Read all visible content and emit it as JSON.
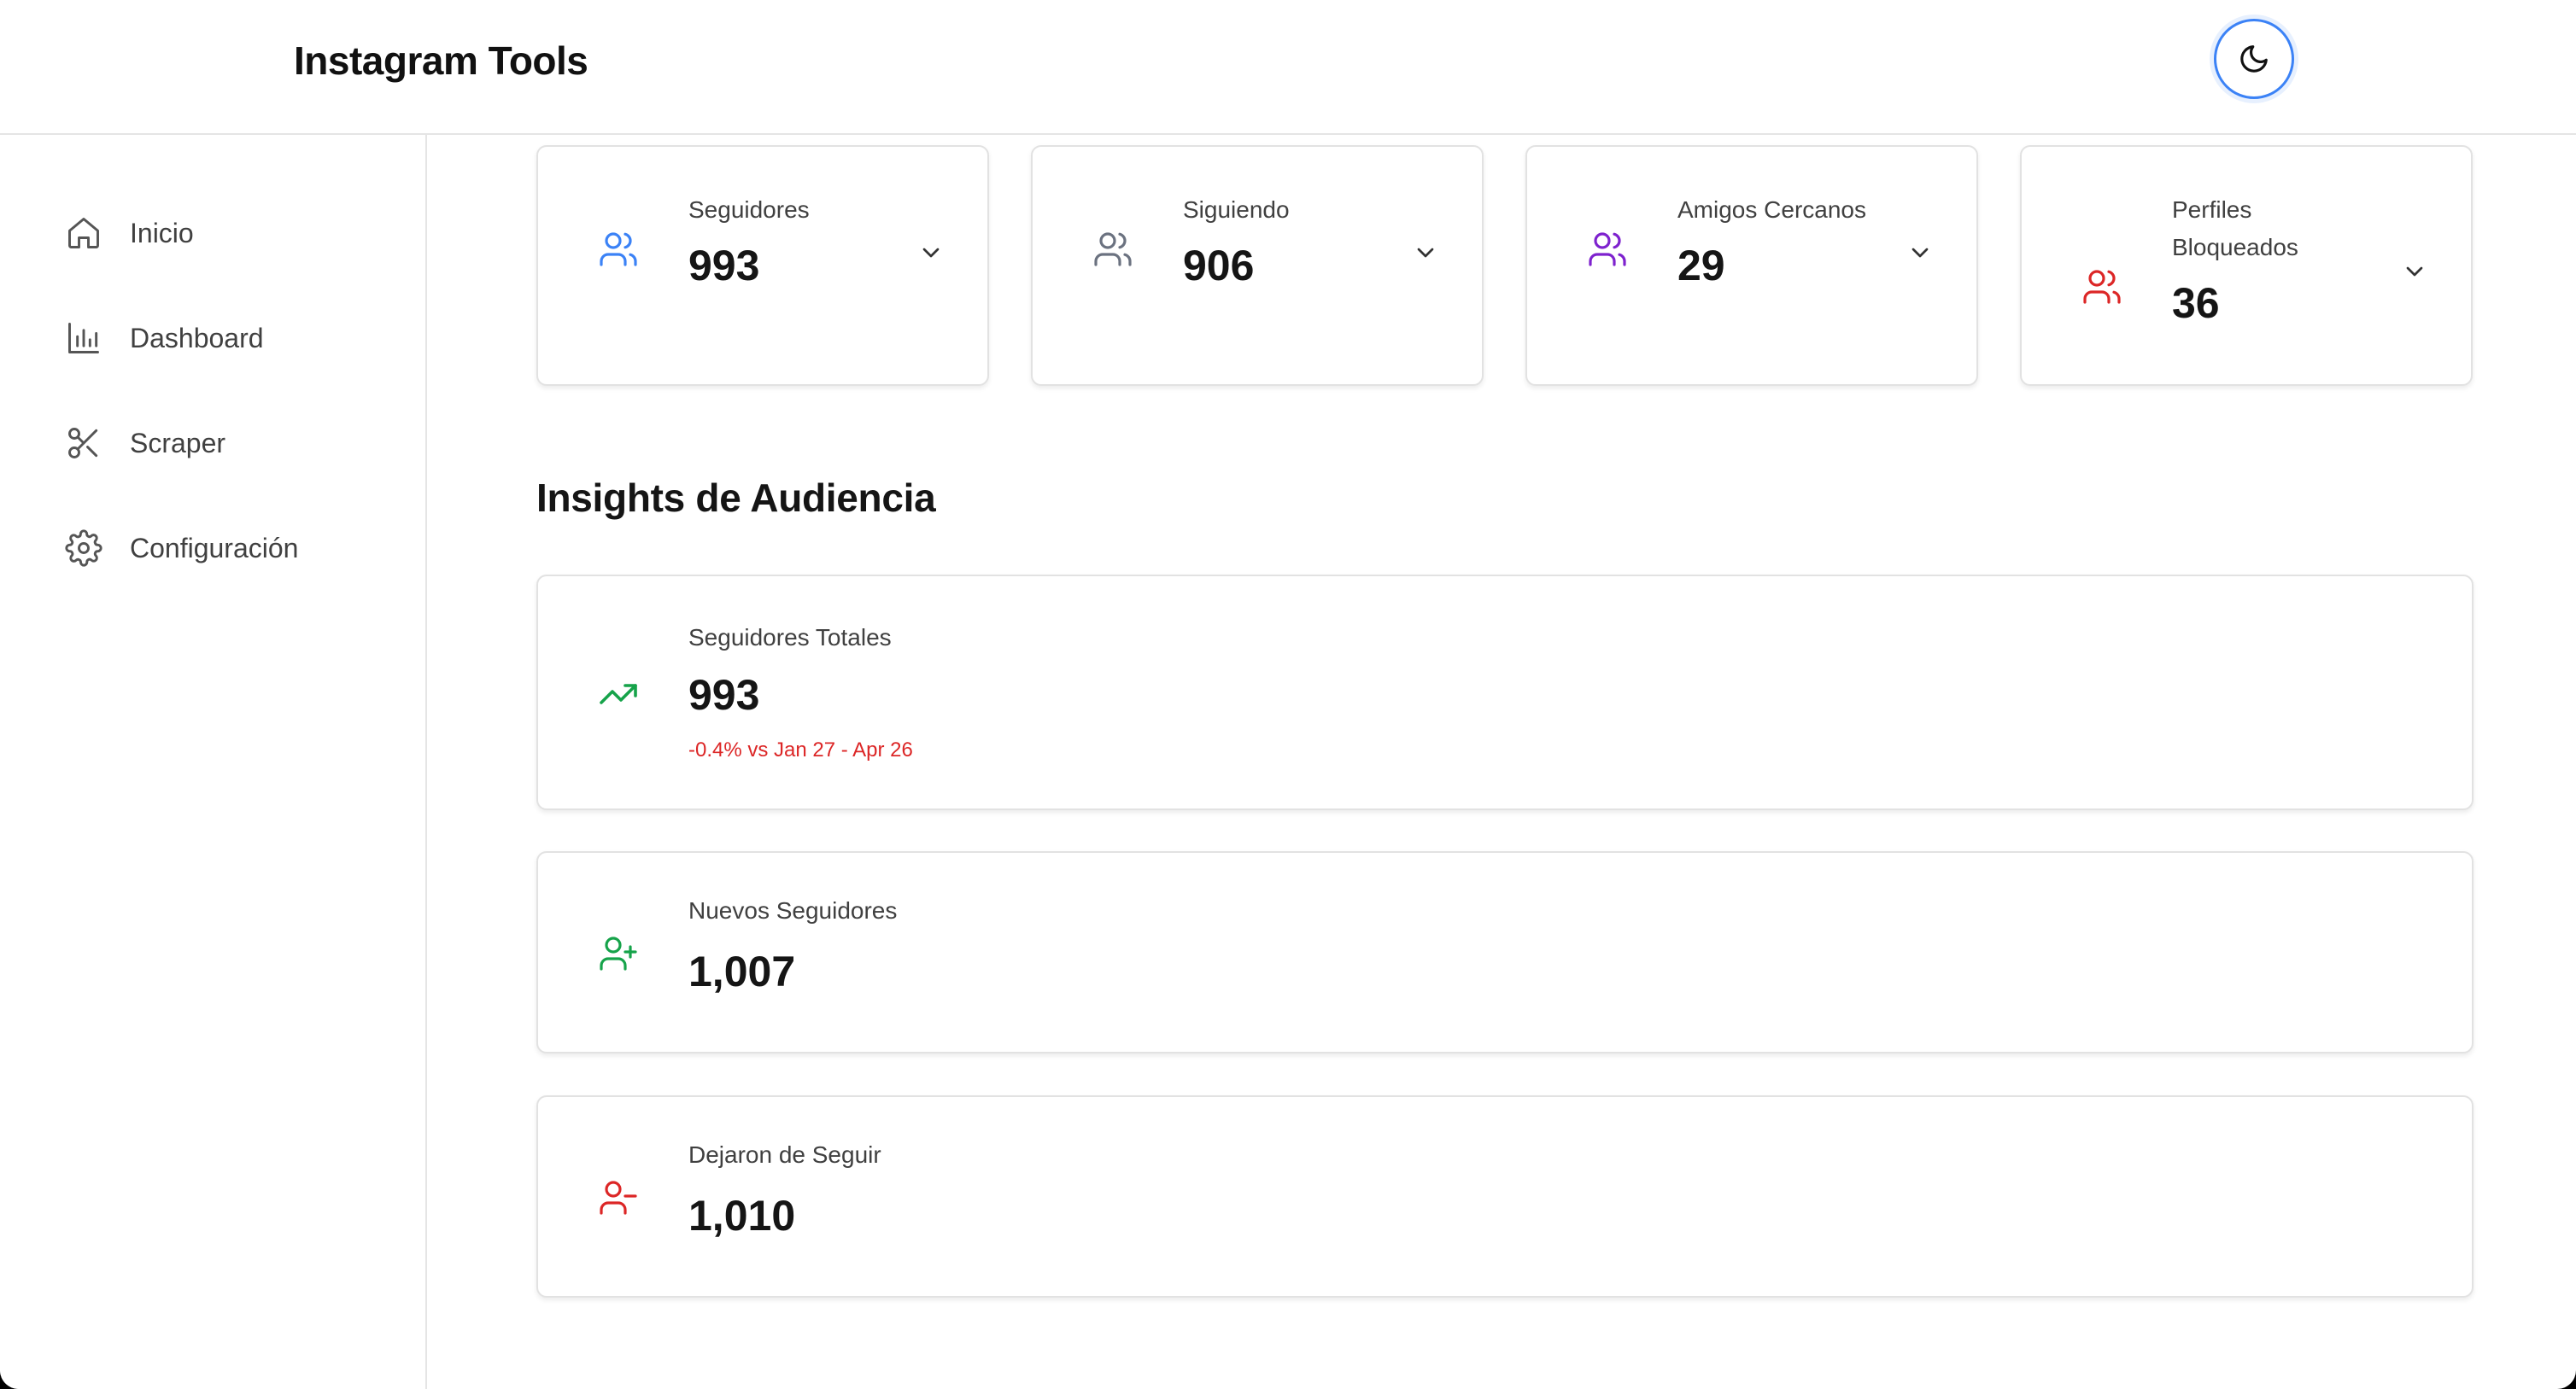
{
  "header": {
    "title": "Instagram Tools",
    "theme_icon": "moon-icon"
  },
  "sidebar": {
    "items": [
      {
        "label": "Inicio",
        "icon": "home-icon"
      },
      {
        "label": "Dashboard",
        "icon": "bar-chart-icon"
      },
      {
        "label": "Scraper",
        "icon": "scissors-icon"
      },
      {
        "label": "Configuración",
        "icon": "gear-icon"
      }
    ]
  },
  "stats": [
    {
      "label": "Seguidores",
      "value": "993",
      "color": "#3b82f6",
      "icon": "users-icon"
    },
    {
      "label": "Siguiendo",
      "value": "906",
      "color": "#6b7280",
      "icon": "users-icon"
    },
    {
      "label": "Amigos Cercanos",
      "value": "29",
      "color": "#7e22ce",
      "icon": "users-icon"
    },
    {
      "label": "Perfiles Bloqueados",
      "value": "36",
      "color": "#dc2626",
      "icon": "users-icon"
    }
  ],
  "insights": {
    "title": "Insights de Audiencia",
    "cards": [
      {
        "label": "Seguidores Totales",
        "value": "993",
        "change": "-0.4% vs Jan 27 - Apr 26",
        "color": "#16a34a",
        "icon": "trending-up-icon"
      },
      {
        "label": "Nuevos Seguidores",
        "value": "1,007",
        "color": "#16a34a",
        "icon": "user-plus-icon"
      },
      {
        "label": "Dejaron de Seguir",
        "value": "1,010",
        "color": "#dc2626",
        "icon": "user-minus-icon"
      }
    ]
  }
}
